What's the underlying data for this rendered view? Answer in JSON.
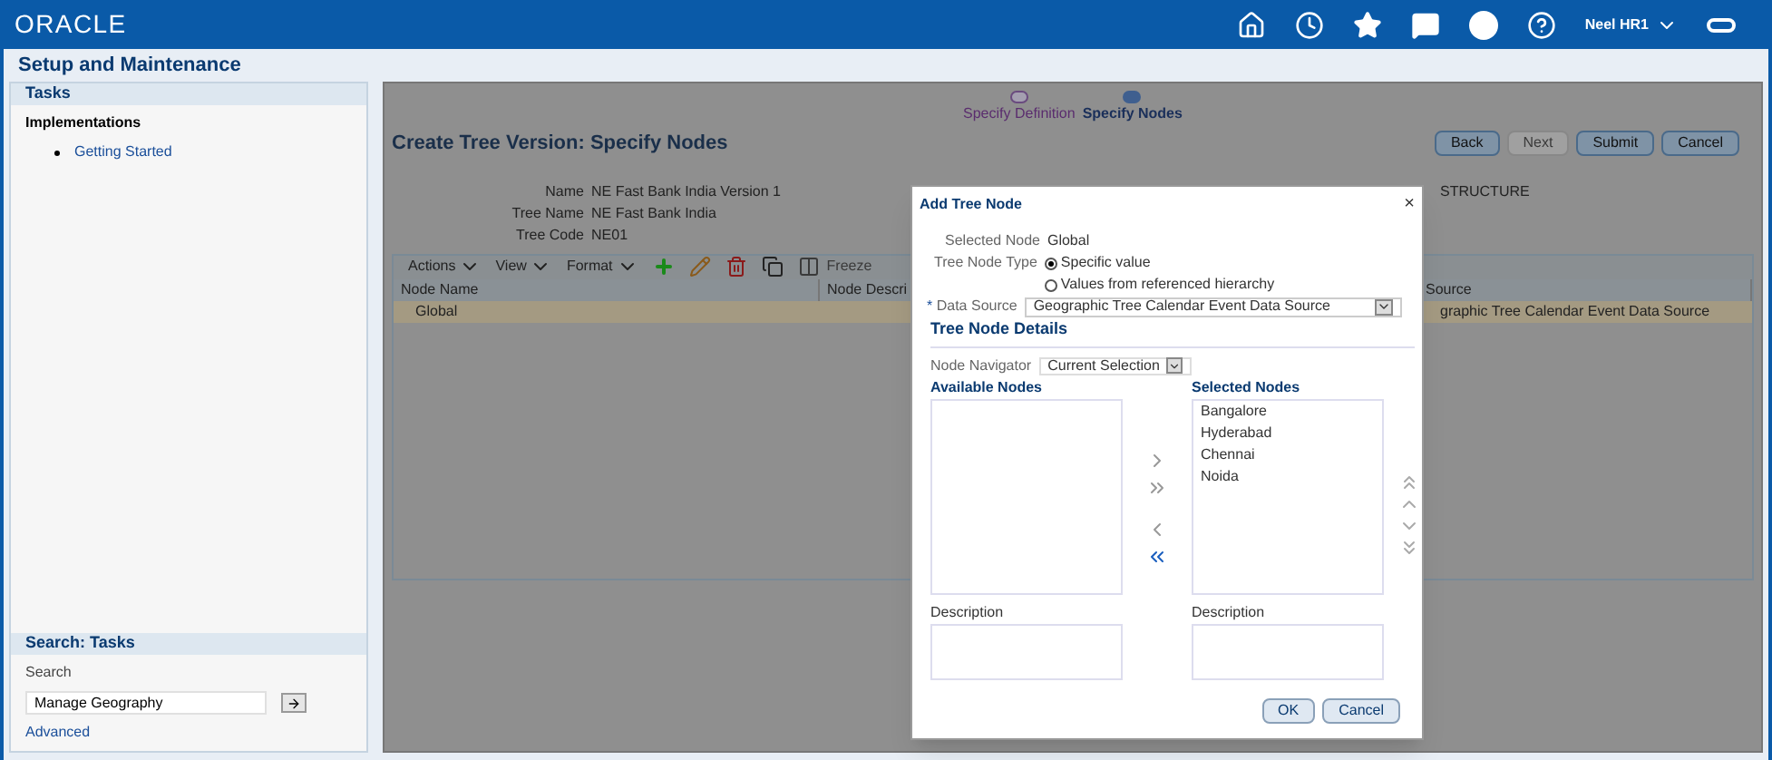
{
  "header": {
    "logo": "ORACLE",
    "user": "Neel HR1"
  },
  "page_title": "Setup and Maintenance",
  "tasks": {
    "title": "Tasks",
    "section": "Implementations",
    "items": [
      "Getting Started"
    ]
  },
  "search_tasks": {
    "title": "Search: Tasks",
    "label": "Search",
    "value": "Manage Geography",
    "link": "Advanced"
  },
  "train": [
    {
      "label": "Specify Definition",
      "selected": false
    },
    {
      "label": "Specify Nodes",
      "selected": true
    }
  ],
  "main": {
    "title": "Create Tree Version: Specify Nodes",
    "buttons": [
      {
        "label": "Back",
        "disabled": false
      },
      {
        "label": "Next",
        "disabled": true
      },
      {
        "label": "Submit",
        "disabled": false
      },
      {
        "label": "Cancel",
        "disabled": false
      }
    ],
    "fields": [
      {
        "label": "Name",
        "value": "NE Fast Bank India Version 1"
      },
      {
        "label": "Tree Name",
        "value": "NE Fast Bank India"
      },
      {
        "label": "Tree Code",
        "value": "NE01"
      }
    ],
    "partial_text": "STRUCTURE",
    "toolbar": {
      "menus": [
        "Actions",
        "View",
        "Format"
      ],
      "freeze": "Freeze"
    },
    "table": {
      "columns": [
        "Node Name",
        "Node Descri",
        "Source"
      ],
      "rows": [
        [
          "Global",
          "",
          "graphic Tree Calendar Event Data Source"
        ]
      ]
    }
  },
  "dialog": {
    "title": "Add Tree Node",
    "close": "×",
    "selected_node_label": "Selected Node",
    "selected_node": "Global",
    "type_label": "Tree Node Type",
    "types": [
      {
        "label": "Specific value",
        "selected": true
      },
      {
        "label": "Values from referenced hierarchy",
        "selected": false
      }
    ],
    "required_mark": "*",
    "data_source_label": "Data Source",
    "data_source": "Geographic Tree Calendar Event Data Source",
    "details_title": "Tree Node Details",
    "navigator_label": "Node Navigator",
    "navigator": "Current Selection",
    "available_title": "Available Nodes",
    "selected_title": "Selected Nodes",
    "selected": [
      "Bangalore",
      "Hyderabad",
      "Chennai",
      "Noida"
    ],
    "description_label_left": "Description",
    "description_label_right": "Description",
    "buttons": [
      "OK",
      "Cancel"
    ]
  }
}
